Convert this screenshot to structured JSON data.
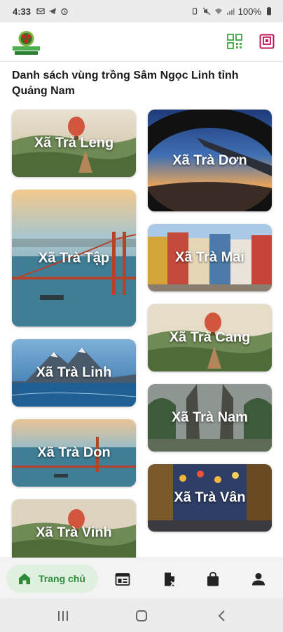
{
  "status_bar": {
    "time": "4:33",
    "battery": "100%"
  },
  "app_bar": {
    "logo_alt": "logo",
    "qr_icon": "qr-code-icon",
    "scan_icon": "scan-icon"
  },
  "page": {
    "title": "Danh sách vùng trồng Sâm Ngọc Linh tỉnh Quảng Nam"
  },
  "regions_left": [
    {
      "name": "Xã Trà Leng",
      "scene": "balloon"
    },
    {
      "name": "Xã Trà Tập",
      "scene": "bridge"
    },
    {
      "name": "Xã Trà Linh",
      "scene": "mountain"
    },
    {
      "name": "Xã Trà Don",
      "scene": "bridge-small"
    },
    {
      "name": "Xã Trà Vinh",
      "scene": "balloon"
    }
  ],
  "regions_right": [
    {
      "name": "Xã Trà Dơn",
      "scene": "plane"
    },
    {
      "name": "Xã Trà Mai",
      "scene": "houses"
    },
    {
      "name": "Xã Trà Cang",
      "scene": "balloon"
    },
    {
      "name": "Xã Trà Nam",
      "scene": "gate"
    },
    {
      "name": "Xã Trà Vân",
      "scene": "lanterns"
    }
  ],
  "bottom_nav": {
    "home_label": "Trang chủ",
    "items": [
      "home-icon",
      "news-icon",
      "document-icon",
      "bag-icon",
      "profile-icon"
    ]
  },
  "colors": {
    "accent_green": "#2e8b3a",
    "accent_pink": "#c2185b",
    "home_pill": "#dff0e0"
  }
}
